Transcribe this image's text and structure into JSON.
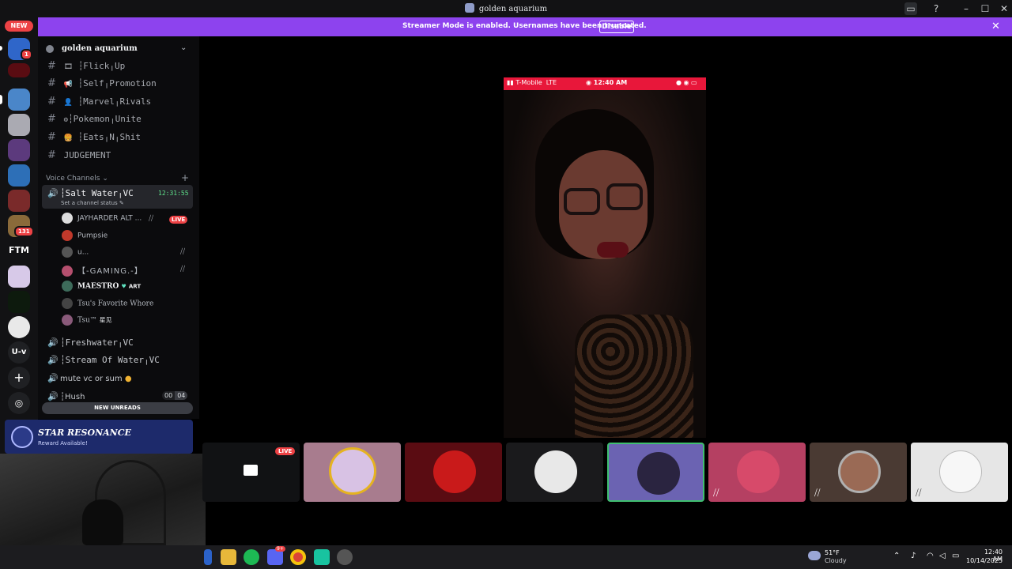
{
  "window": {
    "title": "golden aquarium"
  },
  "banner": {
    "message": "Streamer Mode is enabled. Usernames have been truncated.",
    "disable_label": "Disable"
  },
  "rail": {
    "new_label": "NEW",
    "badge_1": "1",
    "badge_131": "131",
    "ftm_label": "FTM",
    "uv_label": "U-v"
  },
  "sidebar": {
    "guild_name": "golden aquarium",
    "text_channels": [
      "┆Flick╷Up",
      "┆Self╷Promotion",
      "┆Marvel╷Rivals",
      "┆Pokemon╷Unite",
      "┆Eats╷N╷Shit",
      "JUDGEMENT"
    ],
    "voice_header": "Voice Channels",
    "active_vc": {
      "name": "┆Salt Water╷VC",
      "timer": "12:31:55",
      "status": "Set a channel status"
    },
    "members": [
      {
        "name": "JAYHARDER ALT ...",
        "badge": "LIVE"
      },
      {
        "name": "Pumpsie"
      },
      {
        "name": "u..."
      },
      {
        "name": "【-GAMING.-】"
      },
      {
        "name": "MAESTRO",
        "tag": "ART"
      },
      {
        "name": "Tsu's Favorite Whore"
      },
      {
        "name": "Tsu™",
        "tag": "星见"
      }
    ],
    "voice_channels": [
      {
        "name": "┆Freshwater╷VC"
      },
      {
        "name": "┆Stream Of Water╷VC"
      },
      {
        "name": "mute vc or sum"
      },
      {
        "name": "┆Hush",
        "count_a": "00",
        "count_b": "04"
      }
    ],
    "new_unreads": "NEW UNREADS"
  },
  "ad": {
    "title": "STAR RESONANCE",
    "subtitle": "Reward Available!"
  },
  "stage": {
    "status_bar": {
      "carrier": "T-Mobile",
      "network": "LTE",
      "time": "12:40 AM"
    }
  },
  "tiles": {
    "live_badge": "LIVE"
  },
  "taskbar": {
    "discord_badge": "9+",
    "weather_temp": "51°F",
    "weather_desc": "Cloudy",
    "time": "12:40 AM",
    "date": "10/14/2025"
  }
}
